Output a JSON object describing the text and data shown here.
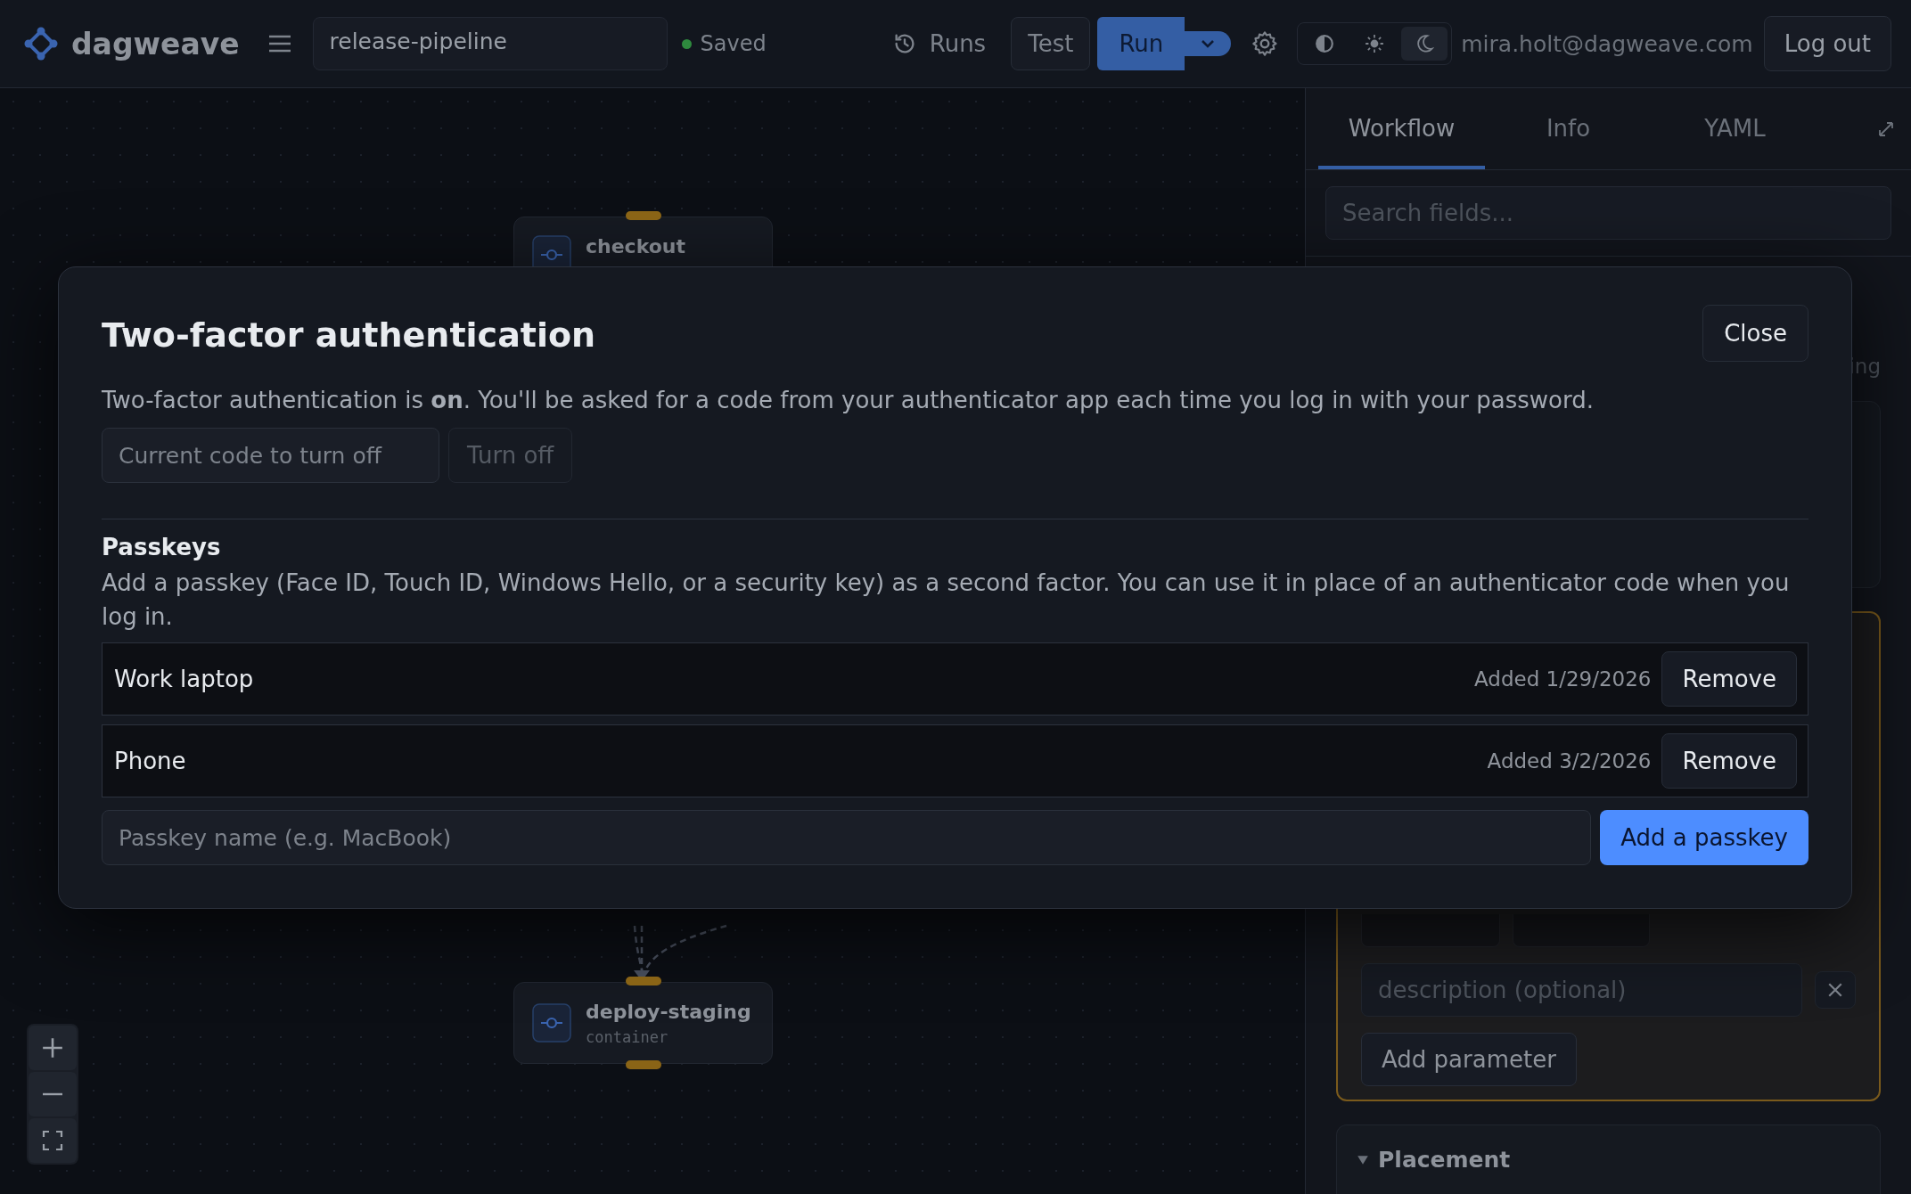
{
  "topbar": {
    "logo": "dagweave",
    "pipeline_name": "release-pipeline",
    "save_status": "Saved",
    "runs": "Runs",
    "test": "Test",
    "run": "Run",
    "theme_options": [
      {
        "kind": "contrast",
        "selected": false
      },
      {
        "kind": "light",
        "selected": false
      },
      {
        "kind": "dark",
        "selected": true
      }
    ],
    "user_email": "mira.holt@dagweave.com",
    "logout": "Log out"
  },
  "canvas": {
    "nodes": [
      {
        "title": "checkout"
      },
      {
        "title": "deploy-staging",
        "subtitle": "container"
      }
    ]
  },
  "panel": {
    "tabs": [
      {
        "label": "Workflow",
        "selected": true
      },
      {
        "label": "Info",
        "selected": false
      },
      {
        "label": "YAML",
        "selected": false
      }
    ],
    "search_placeholder": "Search fields...",
    "fragment": "ing",
    "description_placeholder": "description (optional)",
    "add_parameter": "Add parameter",
    "placement": {
      "title": "Placement",
      "expanded": true
    }
  },
  "modal": {
    "title": "Two-factor authentication",
    "close": "Close",
    "status_text": "Two-factor authentication is **on**. You'll be asked for a code from your authenticator app each time you log in with your password.",
    "code_placeholder": "Current code to turn off",
    "turn_off": {
      "label": "Turn off",
      "disabled": true
    },
    "passkeys_heading": "Passkeys",
    "passkeys_text": "Add a passkey (Face ID, Touch ID, Windows Hello, or a security key) as a second factor. You can use it in place of an authenticator code when you log in.",
    "passkeys": [
      {
        "name": "Work laptop",
        "added": "Added 1/29/2026",
        "action": "Remove"
      },
      {
        "name": "Phone",
        "added": "Added 3/2/2026",
        "action": "Remove"
      }
    ],
    "name_placeholder": "Passkey name (e.g. MacBook)",
    "add_button": "Add a passkey"
  }
}
